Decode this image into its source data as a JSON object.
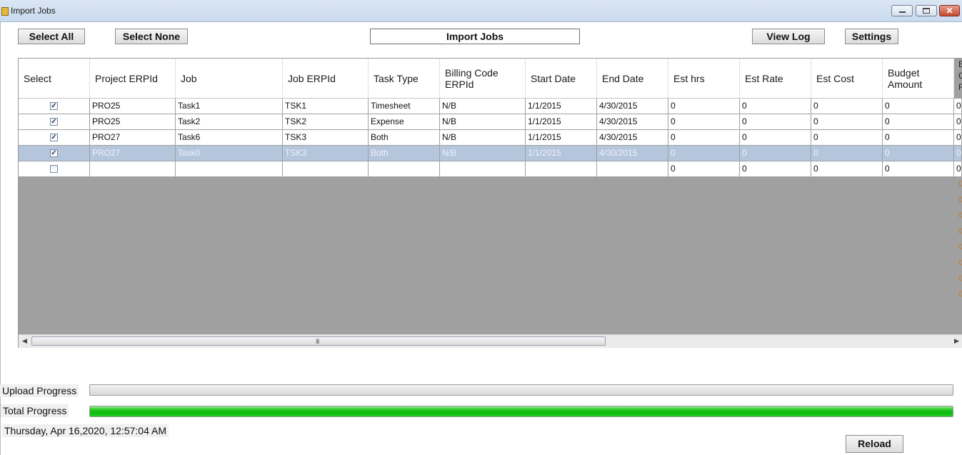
{
  "window": {
    "title": "Import Jobs",
    "min_glyph": "–",
    "max_glyph": "□",
    "close_glyph": "✕"
  },
  "toolbar": {
    "select_all": "Select All",
    "select_none": "Select None",
    "import_jobs": "Import Jobs",
    "view_log": "View Log",
    "settings": "Settings"
  },
  "grid": {
    "columns": [
      "Select",
      "Project ERPId",
      "Job",
      "Job ERPId",
      "Task Type",
      "Billing Code ERPId",
      "Start Date",
      "End Date",
      "Est hrs",
      "Est Rate",
      "Est Cost",
      "Budget Amount"
    ],
    "rows": [
      {
        "checked": true,
        "selected": false,
        "cells": [
          "PRO25",
          "Task1",
          "TSK1",
          "Timesheet",
          "N/B",
          "1/1/2015",
          "4/30/2015",
          "0",
          "0",
          "0",
          "0",
          "0"
        ]
      },
      {
        "checked": true,
        "selected": false,
        "cells": [
          "PRO25",
          "Task2",
          "TSK2",
          "Expense",
          "N/B",
          "1/1/2015",
          "4/30/2015",
          "0",
          "0",
          "0",
          "0",
          "0"
        ]
      },
      {
        "checked": true,
        "selected": false,
        "cells": [
          "PRO27",
          "Task6",
          "TSK3",
          "Both",
          "N/B",
          "1/1/2015",
          "4/30/2015",
          "0",
          "0",
          "0",
          "0",
          "0"
        ]
      },
      {
        "checked": true,
        "selected": true,
        "cells": [
          "PRO27",
          "Task0",
          "TSK3",
          "Both",
          "N/B",
          "1/1/2015",
          "4/30/2015",
          "0",
          "0",
          "0",
          "0",
          "0"
        ]
      },
      {
        "checked": false,
        "selected": false,
        "cells": [
          "",
          "",
          "",
          "",
          "",
          "",
          "",
          "0",
          "0",
          "0",
          "0",
          "0"
        ]
      }
    ],
    "check_mark": "✓",
    "scroll": {
      "left_arrow": "◀",
      "right_arrow": "▶",
      "grip": "III"
    }
  },
  "progress": {
    "upload_label": "Upload Progress",
    "upload_value": 0,
    "total_label": "Total Progress",
    "total_value": 1.0,
    "fill_color": "#11bb11"
  },
  "status": {
    "datetime": "Thursday, Apr 16,2020, 12:57:04 AM"
  },
  "footer": {
    "reload": "Reload"
  }
}
